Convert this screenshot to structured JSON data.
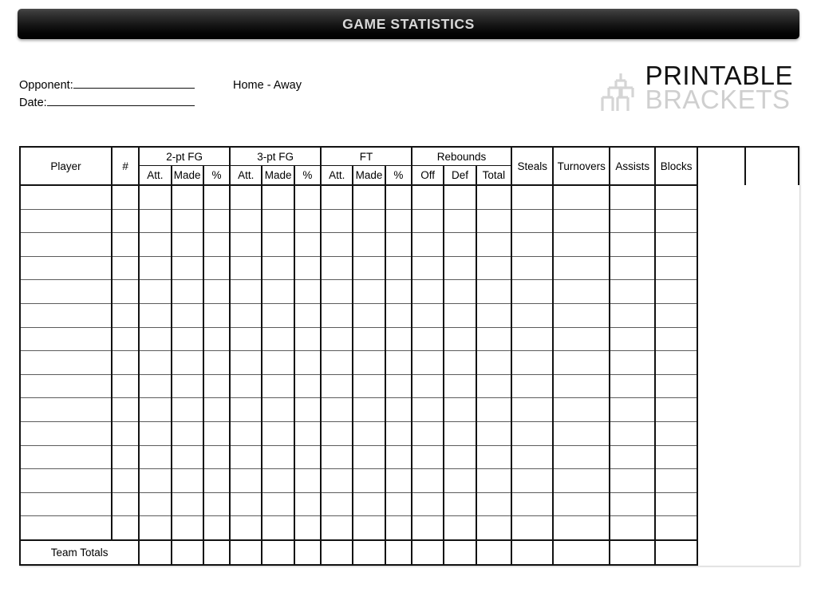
{
  "header": {
    "title": "GAME STATISTICS"
  },
  "meta": {
    "opponent_label": "Opponent:",
    "date_label": "Date:",
    "home_away": "Home - Away"
  },
  "logo": {
    "icon": "bracket-tree-icon",
    "word_primary": "PRINTABLE",
    "word_secondary": "BRACKETS",
    "color_primary": "#111111",
    "color_secondary": "#cfcfcf"
  },
  "table": {
    "group_headers": [
      {
        "label": "Player",
        "span": 1,
        "rowspan": 2
      },
      {
        "label": "#",
        "span": 1,
        "rowspan": 2
      },
      {
        "label": "2-pt FG",
        "span": 3,
        "rowspan": 1
      },
      {
        "label": "3-pt FG",
        "span": 3,
        "rowspan": 1
      },
      {
        "label": "FT",
        "span": 3,
        "rowspan": 1
      },
      {
        "label": "Rebounds",
        "span": 3,
        "rowspan": 1
      },
      {
        "label": "Steals",
        "span": 1,
        "rowspan": 2
      },
      {
        "label": "Turnovers",
        "span": 1,
        "rowspan": 2
      },
      {
        "label": "Assists",
        "span": 1,
        "rowspan": 2
      },
      {
        "label": "Blocks",
        "span": 1,
        "rowspan": 2
      },
      {
        "label": "",
        "span": 1,
        "rowspan": 2
      },
      {
        "label": "",
        "span": 1,
        "rowspan": 2
      }
    ],
    "sub_headers": [
      "Att.",
      "Made",
      "%",
      "Att.",
      "Made",
      "%",
      "Att.",
      "Made",
      "%",
      "Off",
      "Def",
      "Total"
    ],
    "player_row_count": 15,
    "column_count": 18,
    "totals_label": "Team Totals",
    "totals_cell_count": 16,
    "empty_cell_value": ""
  }
}
